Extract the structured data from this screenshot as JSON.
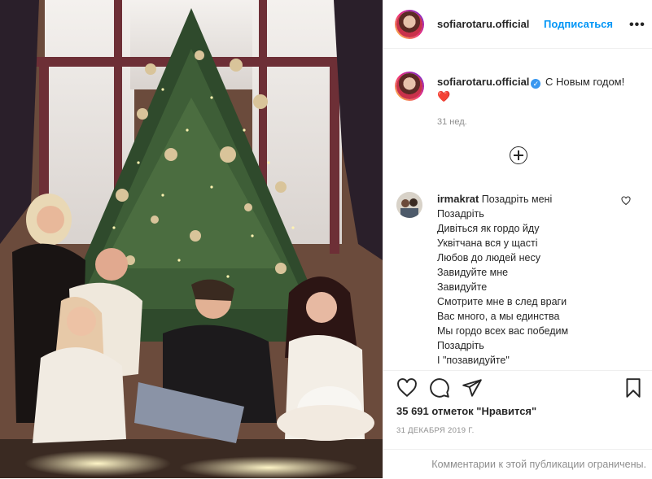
{
  "post": {
    "username": "sofiarotaru.official",
    "follow_label": "Подписаться",
    "more_label": "•••",
    "caption_text": "С Новым годом!",
    "caption_emoji": "❤️",
    "caption_time": "31 нед.",
    "likes": "35 691 отметок \"Нравится\"",
    "date": "31 ДЕКАБРЯ 2019 Г.",
    "comments_limited": "Комментарии к этой публикации ограничены."
  },
  "comment": {
    "username": "irmakrat",
    "lines": [
      "Позадріть мені",
      "Позадріть",
      "Дивіться як гордо йду",
      "Уквітчана вся у щасті",
      "Любов до людей несу",
      "Завидуйте мне",
      "Завидуйте",
      "Смотрите мне в след враги",
      "Вас много, а мы единства",
      "Мы гордо всех вас победим",
      "Позадріть",
      "І \"позавидуйте\""
    ]
  },
  "icons": {
    "like": "heart-icon",
    "comment": "comment-icon",
    "share": "share-icon",
    "save": "bookmark-icon",
    "add_comment": "plus-circle-icon",
    "verified": "verified-badge-icon",
    "comment_like": "heart-small-icon"
  },
  "colors": {
    "link": "#0095f6",
    "muted": "#8e8e8e",
    "verified": "#3897f0",
    "heart": "#ed4956"
  }
}
